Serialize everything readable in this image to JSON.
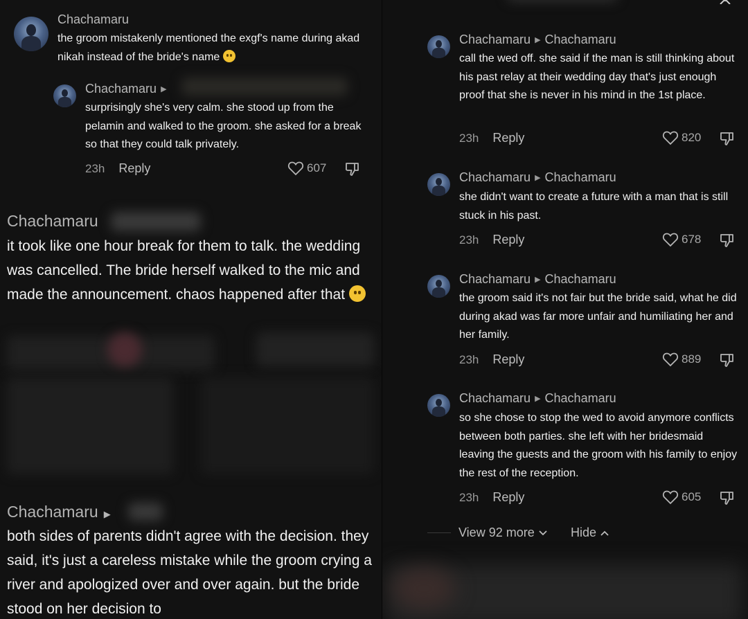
{
  "left": {
    "comment1": {
      "username": "Chachamaru",
      "text": "the groom mistakenly mentioned the exgf's name during akad nikah instead of the bride's name"
    },
    "reply1": {
      "username": "Chachamaru",
      "text": "surprisingly she's very calm. she stood up from the pelamin and walked to the groom. she asked for a break so that they could talk privately.",
      "time": "23h",
      "reply_label": "Reply",
      "likes": "607"
    },
    "big1": {
      "username": "Chachamaru",
      "text": "it took like one hour break for them to talk. the wedding was cancelled. The bride herself walked to the mic and made the announcement. chaos happened after that"
    },
    "big2": {
      "username": "Chachamaru",
      "text": "both sides of parents didn't agree with the decision. they said, it's just a careless mistake while the groom crying a river and apologized over and over again. but the bride stood on her decision to"
    }
  },
  "right": {
    "comments": [
      {
        "author": "Chachamaru",
        "reply_to": "Chachamaru",
        "text": "call the wed off. she said if the man is still thinking about his past relay at their wedding day that's just enough proof that she is never in his mind in the 1st place.",
        "time": "23h",
        "reply_label": "Reply",
        "likes": "820"
      },
      {
        "author": "Chachamaru",
        "reply_to": "Chachamaru",
        "text": "she didn't want to create a future with a man that is still stuck in his past.",
        "time": "23h",
        "reply_label": "Reply",
        "likes": "678"
      },
      {
        "author": "Chachamaru",
        "reply_to": "Chachamaru",
        "text": "the groom said it's not fair but the bride said, what he did during akad was far more unfair and humiliating her and her family.",
        "time": "23h",
        "reply_label": "Reply",
        "likes": "889"
      },
      {
        "author": "Chachamaru",
        "reply_to": "Chachamaru",
        "text": "so she chose to stop the wed to avoid anymore conflicts between both parties. she left with her bridesmaid leaving the guests and the groom with his family to enjoy the rest of the reception.",
        "time": "23h",
        "reply_label": "Reply",
        "likes": "605"
      }
    ],
    "view_more": "View 92 more",
    "hide": "Hide"
  },
  "icons": {
    "heart": "heart-icon",
    "dislike": "dislike-icon",
    "arrow": "triangle-right-icon",
    "close": "close-icon"
  },
  "colors": {
    "background": "#121212",
    "text": "#f0f0f0",
    "muted": "#9a9a9a"
  }
}
